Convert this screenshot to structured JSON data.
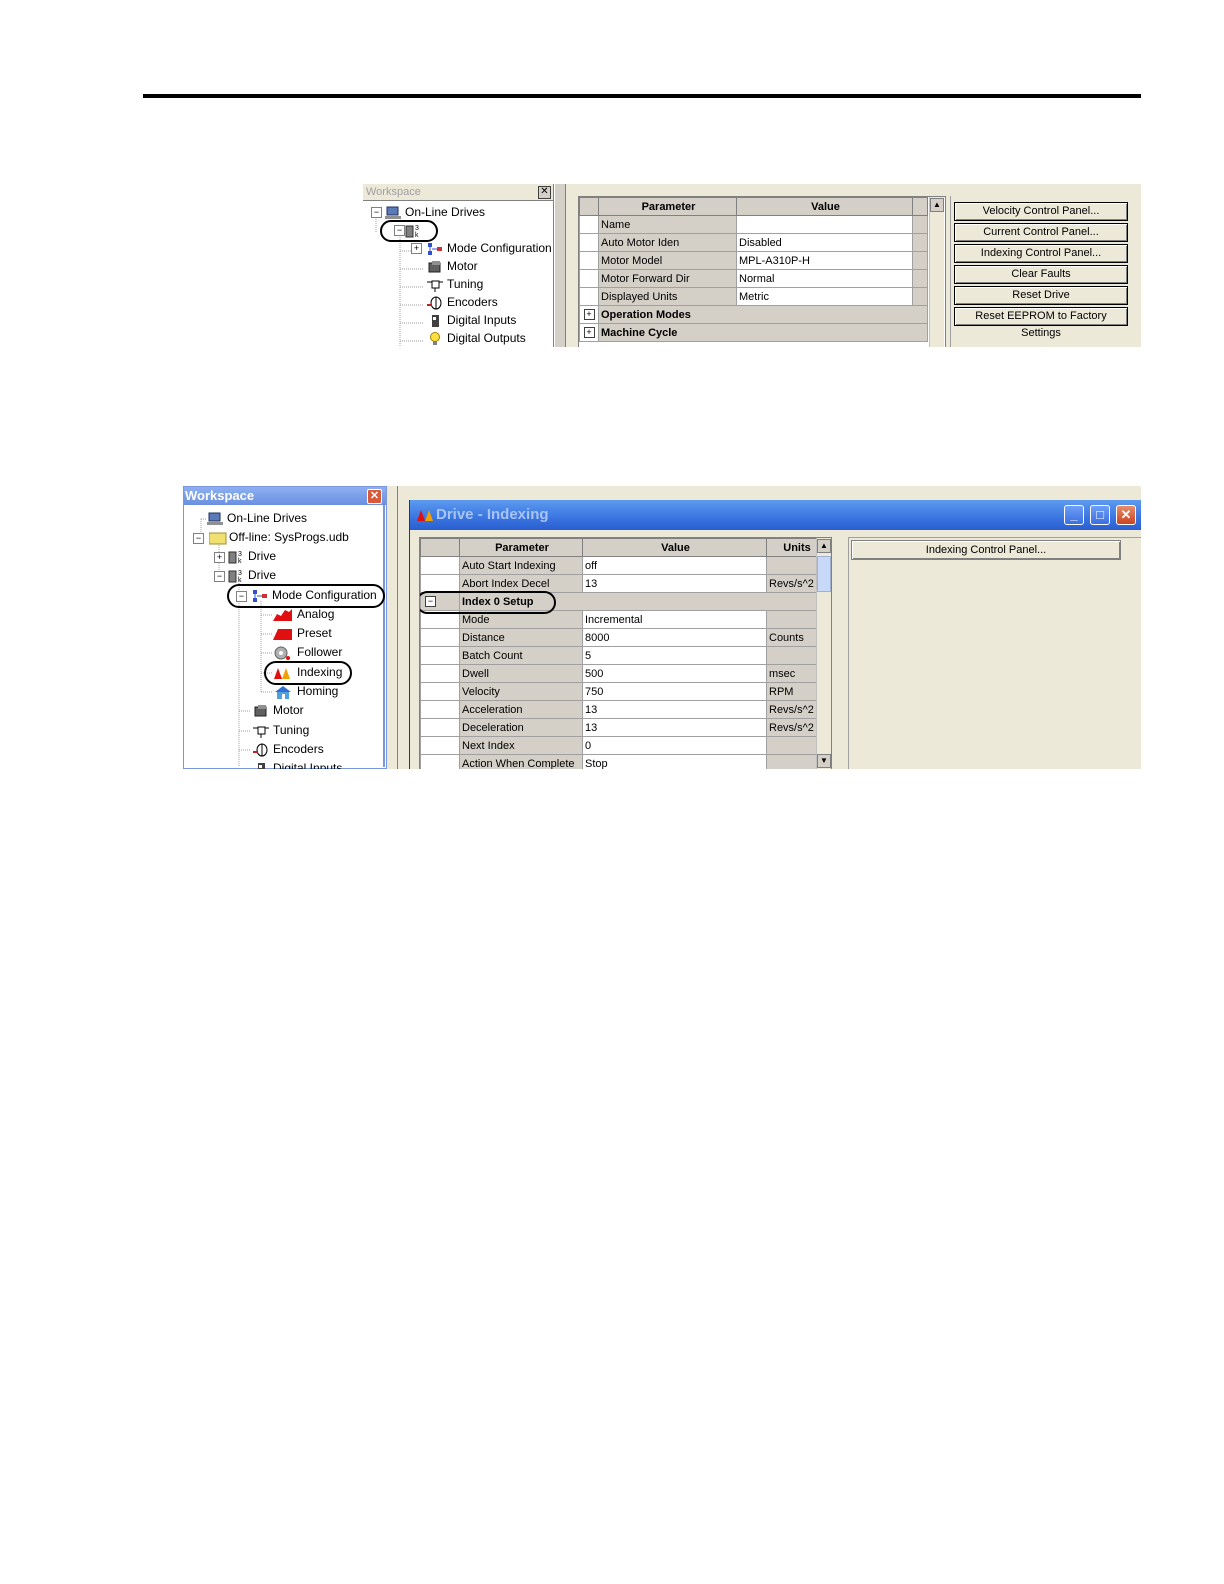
{
  "shot1": {
    "workspace": {
      "title": "Workspace",
      "close": "✕",
      "tree": [
        {
          "label": "On-Line Drives",
          "icon": "computer-icon"
        },
        {
          "label": "",
          "icon": "drive-icon"
        },
        {
          "label": "Mode Configuration",
          "icon": "mode-configuration-icon"
        },
        {
          "label": "Motor",
          "icon": "motor-icon"
        },
        {
          "label": "Tuning",
          "icon": "tuning-icon"
        },
        {
          "label": "Encoders",
          "icon": "encoder-icon"
        },
        {
          "label": "Digital Inputs",
          "icon": "digital-inputs-icon"
        },
        {
          "label": "Digital Outputs",
          "icon": "digital-outputs-icon"
        }
      ]
    },
    "grid": {
      "headers": [
        "Parameter",
        "Value"
      ],
      "rows": [
        {
          "param": "Name",
          "value": ""
        },
        {
          "param": "Auto Motor Iden",
          "value": "Disabled"
        },
        {
          "param": "Motor Model",
          "value": "MPL-A310P-H"
        },
        {
          "param": "Motor Forward Dir",
          "value": "Normal"
        },
        {
          "param": "Displayed Units",
          "value": "Metric"
        }
      ],
      "groups": [
        "Operation Modes",
        "Machine Cycle"
      ]
    },
    "buttons": [
      "Velocity Control Panel...",
      "Current Control Panel...",
      "Indexing Control Panel...",
      "Clear Faults",
      "Reset Drive",
      "Reset EEPROM to Factory Settings"
    ]
  },
  "shot2": {
    "workspace": {
      "title": "Workspace",
      "close": "✕",
      "tree": [
        {
          "label": "On-Line Drives",
          "icon": "computer-icon"
        },
        {
          "label": "Off-line: SysProgs.udb",
          "icon": "folder-icon"
        },
        {
          "label": "Drive",
          "icon": "drive-icon"
        },
        {
          "label": "Drive",
          "icon": "drive-icon"
        },
        {
          "label": "Mode Configuration",
          "icon": "mode-configuration-icon"
        },
        {
          "label": "Analog",
          "icon": "analog-icon"
        },
        {
          "label": "Preset",
          "icon": "preset-icon"
        },
        {
          "label": "Follower",
          "icon": "follower-icon"
        },
        {
          "label": "Indexing",
          "icon": "indexing-icon"
        },
        {
          "label": "Homing",
          "icon": "homing-icon"
        },
        {
          "label": "Motor",
          "icon": "motor-icon"
        },
        {
          "label": "Tuning",
          "icon": "tuning-icon"
        },
        {
          "label": "Encoders",
          "icon": "encoder-icon"
        },
        {
          "label": "Digital Inputs",
          "icon": "digital-inputs-icon"
        }
      ]
    },
    "window": {
      "title": "Drive - Indexing",
      "minimize": "_",
      "maximize": "□",
      "close": "✕"
    },
    "grid": {
      "headers": [
        "Parameter",
        "Value",
        "Units"
      ],
      "rows_top": [
        {
          "param": "Auto Start Indexing",
          "value": "off",
          "units": ""
        },
        {
          "param": "Abort Index Decel",
          "value": "13",
          "units": "Revs/s^2"
        }
      ],
      "group": "Index 0 Setup",
      "rows": [
        {
          "param": "Mode",
          "value": "Incremental",
          "units": ""
        },
        {
          "param": "Distance",
          "value": "8000",
          "units": "Counts"
        },
        {
          "param": "Batch Count",
          "value": "5",
          "units": ""
        },
        {
          "param": "Dwell",
          "value": "500",
          "units": "msec"
        },
        {
          "param": "Velocity",
          "value": "750",
          "units": "RPM"
        },
        {
          "param": "Acceleration",
          "value": "13",
          "units": "Revs/s^2"
        },
        {
          "param": "Deceleration",
          "value": "13",
          "units": "Revs/s^2"
        },
        {
          "param": "Next Index",
          "value": "0",
          "units": ""
        },
        {
          "param": "Action When Complete",
          "value": "Stop",
          "units": ""
        }
      ]
    },
    "button": "Indexing Control Panel..."
  }
}
